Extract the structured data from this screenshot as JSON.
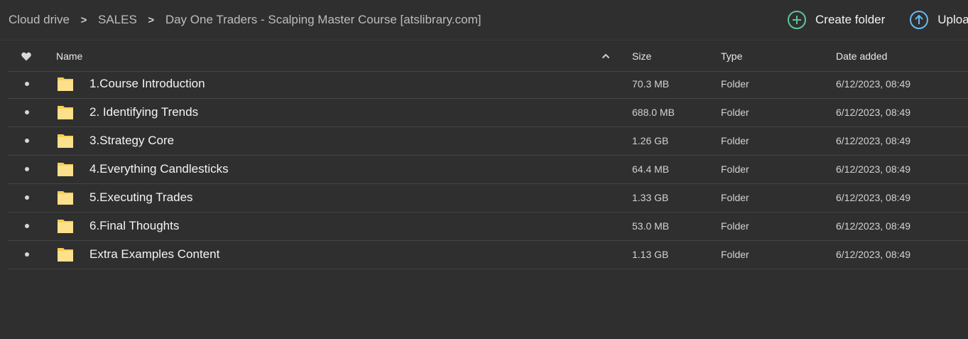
{
  "breadcrumb": {
    "items": [
      "Cloud drive",
      "SALES",
      "Day One Traders - Scalping Master Course [atslibrary.com]"
    ],
    "separator": ">"
  },
  "actions": {
    "create_folder": "Create folder",
    "upload": "Upload"
  },
  "table": {
    "headers": {
      "favourite_icon": "heart-icon",
      "name": "Name",
      "size": "Size",
      "type": "Type",
      "date_added": "Date added"
    },
    "sort_icon": "chevron-up-icon",
    "rows": [
      {
        "name": "1.Course Introduction",
        "size": "70.3 MB",
        "type": "Folder",
        "date": "6/12/2023, 08:49"
      },
      {
        "name": "2. Identifying Trends",
        "size": "688.0 MB",
        "type": "Folder",
        "date": "6/12/2023, 08:49"
      },
      {
        "name": "3.Strategy Core",
        "size": "1.26 GB",
        "type": "Folder",
        "date": "6/12/2023, 08:49"
      },
      {
        "name": "4.Everything Candlesticks",
        "size": "64.4 MB",
        "type": "Folder",
        "date": "6/12/2023, 08:49"
      },
      {
        "name": "5.Executing Trades",
        "size": "1.33 GB",
        "type": "Folder",
        "date": "6/12/2023, 08:49"
      },
      {
        "name": "6.Final Thoughts",
        "size": "53.0 MB",
        "type": "Folder",
        "date": "6/12/2023, 08:49"
      },
      {
        "name": "Extra Examples Content",
        "size": "1.13 GB",
        "type": "Folder",
        "date": "6/12/2023, 08:49"
      }
    ]
  },
  "colors": {
    "background": "#2f2f2f",
    "create_accent": "#5cc49a",
    "upload_accent": "#67b8f0",
    "folder": "#f7cf55"
  }
}
